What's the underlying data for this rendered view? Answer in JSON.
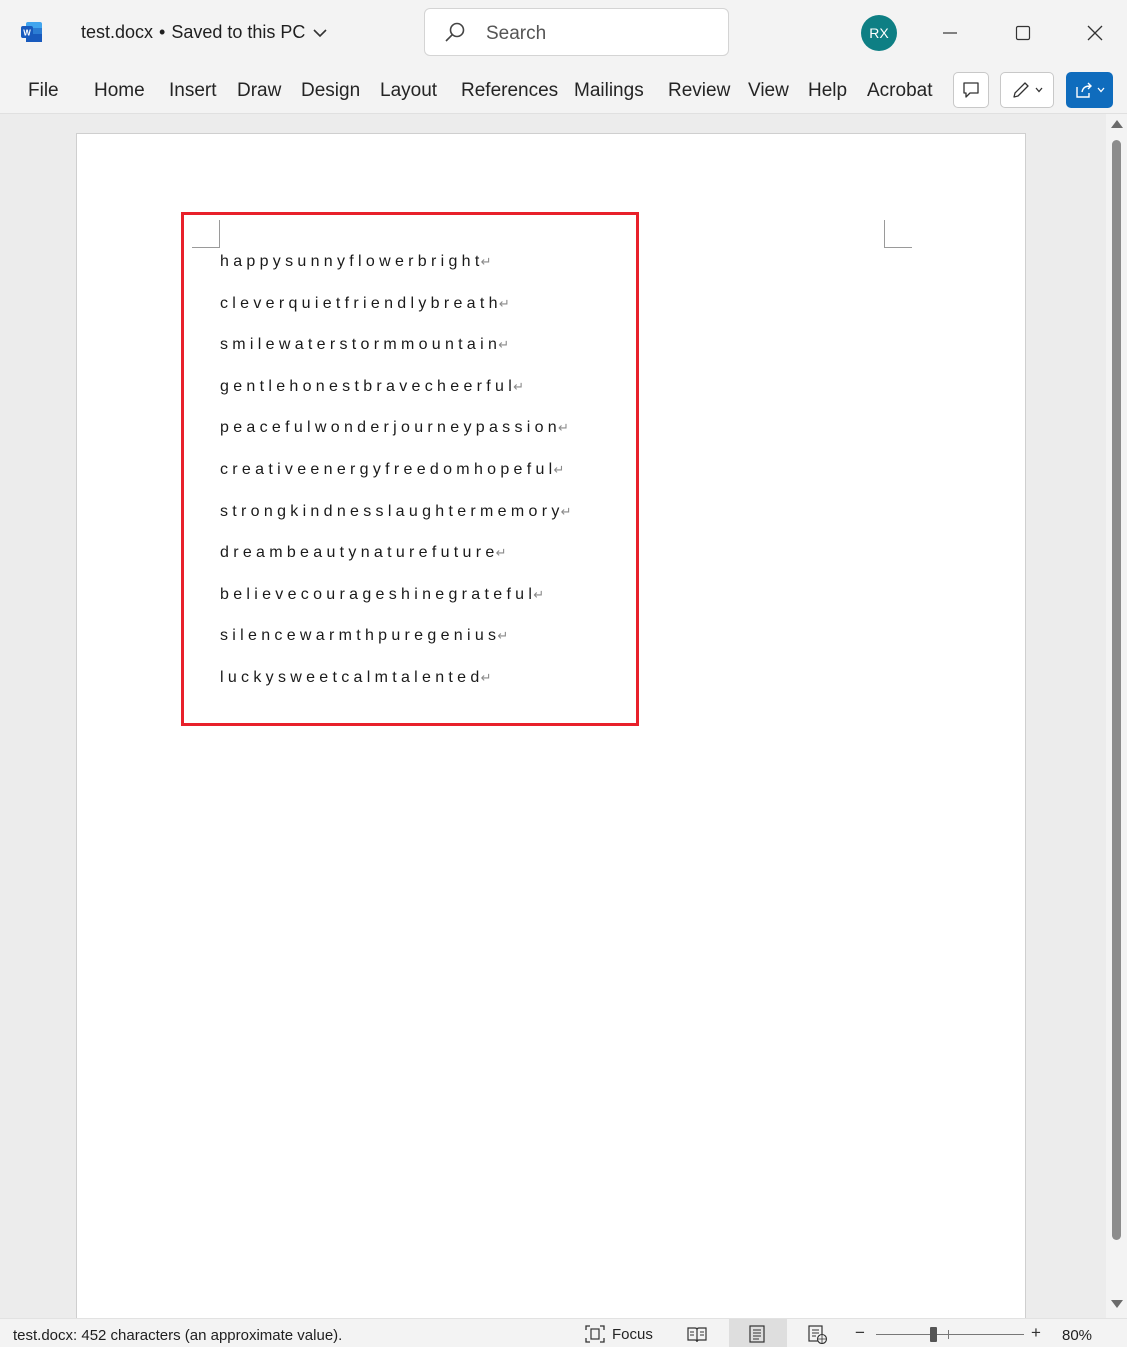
{
  "app": {
    "icon": "word-app-icon",
    "accent": "#185abd"
  },
  "titlebar": {
    "filename": "test.docx",
    "separator": "•",
    "save_status": "Saved to this PC",
    "search_placeholder": "Search",
    "avatar_initials": "RX",
    "avatar_color": "#0e7f84"
  },
  "ribbon": {
    "tabs": [
      "File",
      "Home",
      "Insert",
      "Draw",
      "Design",
      "Layout",
      "References",
      "Mailings",
      "Review",
      "View",
      "Help",
      "Acrobat"
    ]
  },
  "document": {
    "lines": [
      "happysunnyflowerbright",
      "cleverquietfriendlybreath",
      "smilewaterstormmountain",
      "gentlehonestbravecheerful",
      "peacefulwonderjourneypassion",
      "creativeenergyfreedomhopeful",
      "strongkindnesslaughtermemory",
      "dreambeautynaturefuture",
      "believecourageshinegrateful",
      "silencewarmthpuregenius",
      "luckysweetcalmtalented"
    ],
    "paragraph_mark": "↵",
    "highlight_color": "#e8202a"
  },
  "statusbar": {
    "info": "test.docx: 452 characters (an approximate value).",
    "focus_label": "Focus",
    "zoom_minus": "−",
    "zoom_plus": "+",
    "zoom_level": "80%"
  }
}
